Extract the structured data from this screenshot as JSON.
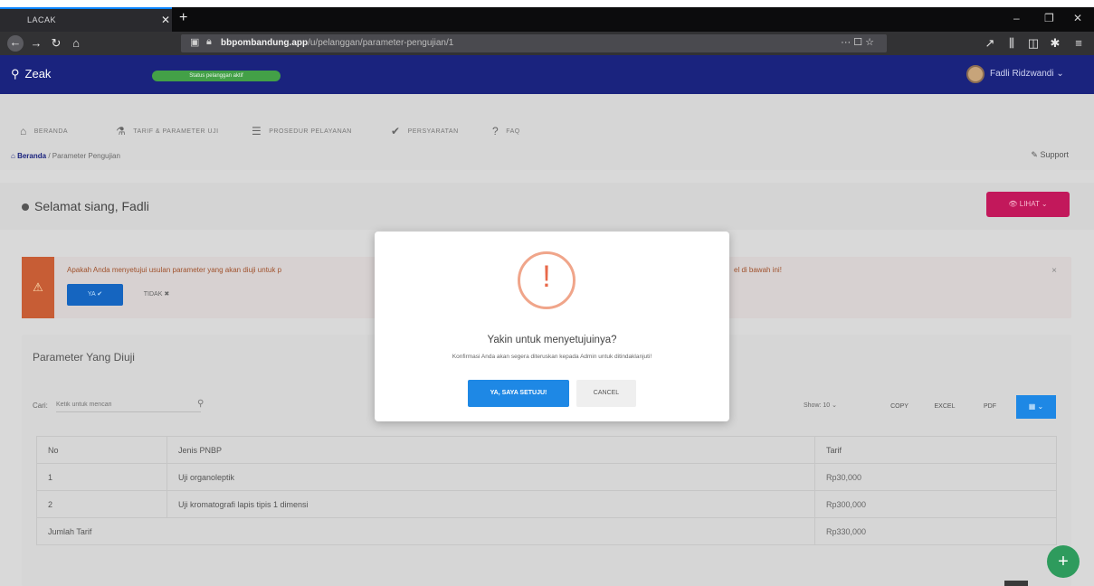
{
  "browser": {
    "tab_title": "LACAK",
    "tab_close": "✕",
    "new_tab": "+",
    "url_domain": "bbpombandung.app",
    "url_rest": "/u/pelanggan/parameter-pengujian/1",
    "url_tools": "··· ☐ ☆",
    "win_min": "–",
    "win_max": "❐",
    "win_close": "✕"
  },
  "app": {
    "brand": "Zeak",
    "status_badge": "Status pelanggan aktif",
    "user_name": "Fadli Ridzwandi"
  },
  "menu": {
    "items": [
      {
        "label": "BERANDA",
        "icon": "home-icon"
      },
      {
        "label": "TARIF & PARAMETER UJI",
        "icon": "flask-icon"
      },
      {
        "label": "PROSEDUR PELAYANAN",
        "icon": "list-icon"
      },
      {
        "label": "PERSYARATAN",
        "icon": "check-icon"
      },
      {
        "label": "FAQ",
        "icon": "help-icon"
      }
    ]
  },
  "breadcrumb": {
    "home": "Beranda",
    "sep": "/",
    "current": "Parameter Pengujian"
  },
  "support": "Support",
  "greeting": "Selamat siang, Fadli",
  "lihat_button": "LIHAT",
  "alert": {
    "message": "Apakah Anda menyetujui usulan parameter yang akan diuji untuk p",
    "message_end": "el di bawah ini!",
    "yes_label": "YA",
    "no_label": "TIDAK",
    "close": "×"
  },
  "card": {
    "title": "Parameter Yang Diuji",
    "search_label": "Cari:",
    "search_placeholder": "Ketik untuk mencari",
    "show_label": "Show: 10",
    "buttons": [
      "COPY",
      "EXCEL",
      "PDF"
    ]
  },
  "table": {
    "headers": [
      "No",
      "Jenis PNBP",
      "Tarif"
    ],
    "rows": [
      {
        "no": "1",
        "jenis": "Uji organoleptik",
        "tarif": "Rp30,000"
      },
      {
        "no": "2",
        "jenis": "Uji kromatografi lapis tipis 1 dimensi",
        "tarif": "Rp300,000"
      }
    ],
    "total_label": "Jumlah Tarif",
    "total_value": "Rp330,000"
  },
  "modal": {
    "icon_glyph": "!",
    "title": "Yakin untuk menyetujuinya?",
    "subtitle": "Konfirmasi Anda akan segera diteruskan kepada Admin untuk ditindaklanjuti!",
    "confirm_label": "YA, SAYA SETUJU!",
    "cancel_label": "CANCEL"
  },
  "fab_label": "+",
  "colors": {
    "app_header": "#1a237e",
    "primary_button": "#1e88e5",
    "warning_icon": "#e8694a",
    "alert_stripe": "#c75d35",
    "lihat_button": "#c2185b",
    "fab": "#2e9b5d"
  }
}
